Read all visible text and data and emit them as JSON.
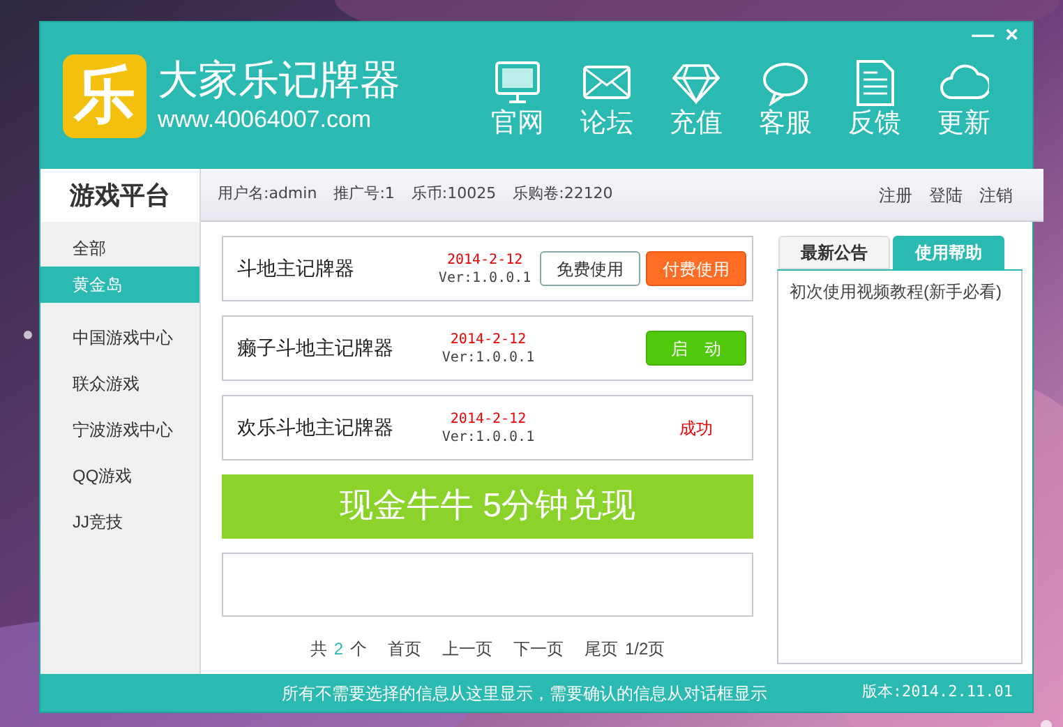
{
  "window": {
    "controls": [
      "—",
      "×"
    ]
  },
  "logo": {
    "mark": "乐",
    "title": "大家乐记牌器",
    "url": "www.40064007.com"
  },
  "toolbar": [
    {
      "label": "官网",
      "kind": "monitor"
    },
    {
      "label": "论坛",
      "kind": "mail"
    },
    {
      "label": "充值",
      "kind": "diamond"
    },
    {
      "label": "客服",
      "kind": "chat"
    },
    {
      "label": "反馈",
      "kind": "document"
    },
    {
      "label": "更新",
      "kind": "cloud"
    }
  ],
  "sidebar": {
    "title": "游戏平台",
    "items": [
      {
        "label": "全部",
        "selected": false
      },
      {
        "label": "黄金岛",
        "selected": true
      },
      {
        "label": "中国游戏中心",
        "selected": false
      },
      {
        "label": "联众游戏",
        "selected": false
      },
      {
        "label": "宁波游戏中心",
        "selected": false
      },
      {
        "label": "QQ游戏",
        "selected": false
      },
      {
        "label": "JJ竞技",
        "selected": false
      }
    ]
  },
  "user_bar": {
    "fields": [
      "用户名:admin",
      "推广号:1",
      "乐币:10025",
      "乐购卷:22120"
    ],
    "links": [
      "注册",
      "登陆",
      "注销"
    ]
  },
  "games": [
    {
      "name": "斗地主记牌器",
      "date": "2014-2-12",
      "version": "Ver:1.0.0.1",
      "kind": "buttons",
      "actions": [
        {
          "label": "免费使用",
          "kind": "outline"
        },
        {
          "label": "付费使用",
          "kind": "orange"
        }
      ]
    },
    {
      "name": "癞子斗地主记牌器",
      "date": "2014-2-12",
      "version": "Ver:1.0.0.1",
      "kind": "buttons",
      "actions": [
        {
          "label": "启　动",
          "kind": "green"
        }
      ]
    },
    {
      "name": "欢乐斗地主记牌器",
      "date": "2014-2-12",
      "version": "Ver:1.0.0.1",
      "kind": "status",
      "status": "成功"
    }
  ],
  "banner": "现金牛牛 5分钟兑现",
  "pagination": {
    "prefix": "共",
    "count": "2",
    "suffix": "个",
    "links": [
      "首页",
      "上一页",
      "下一页",
      "尾页"
    ],
    "page": "1/2页"
  },
  "notice_panel": {
    "tabs": [
      {
        "label": "最新公告",
        "selected": false
      },
      {
        "label": "使用帮助",
        "selected": true
      }
    ],
    "items": [
      "初次使用视频教程(新手必看)"
    ]
  },
  "status_bar": {
    "message": "所有不需要选择的信息从这里显示，需要确认的信息从对话框显示",
    "version": "版本:2014.2.11.01"
  }
}
